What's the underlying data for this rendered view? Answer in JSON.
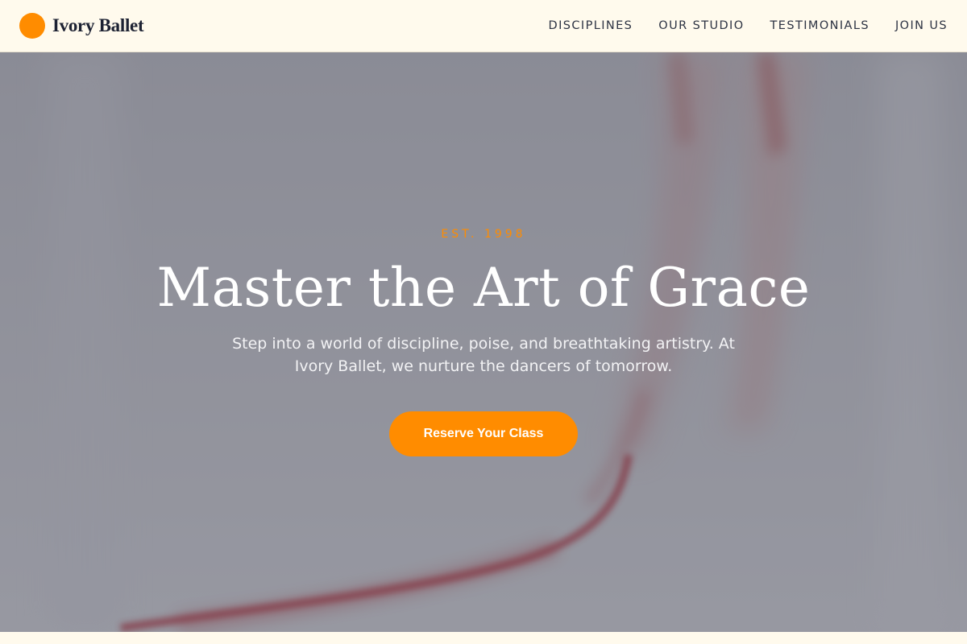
{
  "brand": {
    "name": "Ivory Ballet",
    "accent_color": "#ff8c00"
  },
  "nav": {
    "items": [
      {
        "label": "DISCIPLINES"
      },
      {
        "label": "OUR STUDIO"
      },
      {
        "label": "TESTIMONIALS"
      },
      {
        "label": "JOIN US"
      }
    ]
  },
  "hero": {
    "eyebrow": "EST. 1998",
    "headline": "Master the Art of Grace",
    "subtitle": "Step into a world of discipline, poise, and breathtaking artistry. At Ivory Ballet, we nurture the dancers of tomorrow.",
    "cta_label": "Reserve Your Class"
  }
}
